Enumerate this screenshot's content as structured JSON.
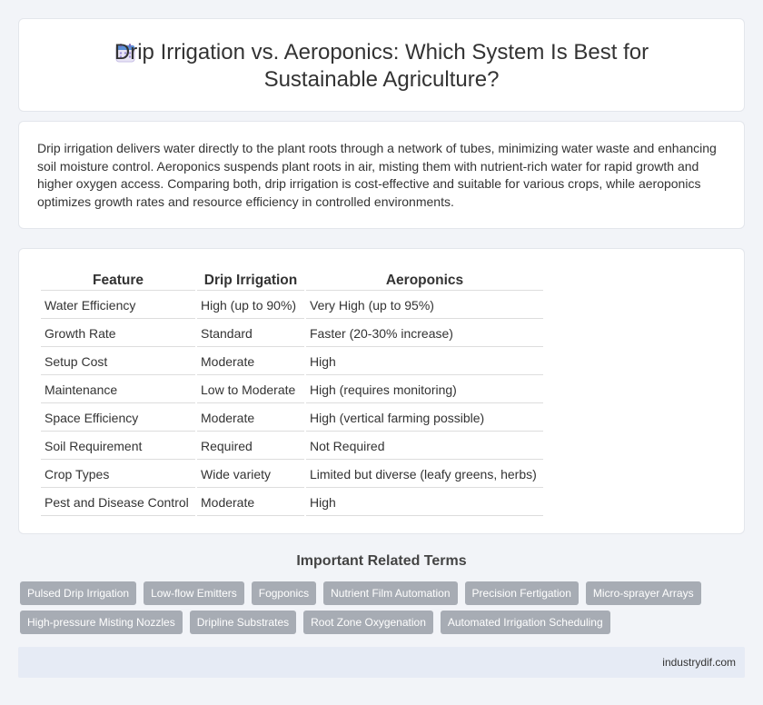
{
  "header": {
    "title": "Drip Irrigation vs. Aeroponics: Which System Is Best for Sustainable Agriculture?",
    "icon": "calendar-icon"
  },
  "intro": {
    "text": "Drip irrigation delivers water directly to the plant roots through a network of tubes, minimizing water waste and enhancing soil moisture control. Aeroponics suspends plant roots in air, misting them with nutrient-rich water for rapid growth and higher oxygen access. Comparing both, drip irrigation is cost-effective and suitable for various crops, while aeroponics optimizes growth rates and resource efficiency in controlled environments."
  },
  "table": {
    "headers": [
      "Feature",
      "Drip Irrigation",
      "Aeroponics"
    ],
    "rows": [
      [
        "Water Efficiency",
        "High (up to 90%)",
        "Very High (up to 95%)"
      ],
      [
        "Growth Rate",
        "Standard",
        "Faster (20-30% increase)"
      ],
      [
        "Setup Cost",
        "Moderate",
        "High"
      ],
      [
        "Maintenance",
        "Low to Moderate",
        "High (requires monitoring)"
      ],
      [
        "Space Efficiency",
        "Moderate",
        "High (vertical farming possible)"
      ],
      [
        "Soil Requirement",
        "Required",
        "Not Required"
      ],
      [
        "Crop Types",
        "Wide variety",
        "Limited but diverse (leafy greens, herbs)"
      ],
      [
        "Pest and Disease Control",
        "Moderate",
        "High"
      ]
    ]
  },
  "related": {
    "title": "Important Related Terms",
    "tags": [
      "Pulsed Drip Irrigation",
      "Low-flow Emitters",
      "Fogponics",
      "Nutrient Film Automation",
      "Precision Fertigation",
      "Micro-sprayer Arrays",
      "High-pressure Misting Nozzles",
      "Dripline Substrates",
      "Root Zone Oxygenation",
      "Automated Irrigation Scheduling"
    ]
  },
  "footer": {
    "site": "industrydif.com"
  }
}
